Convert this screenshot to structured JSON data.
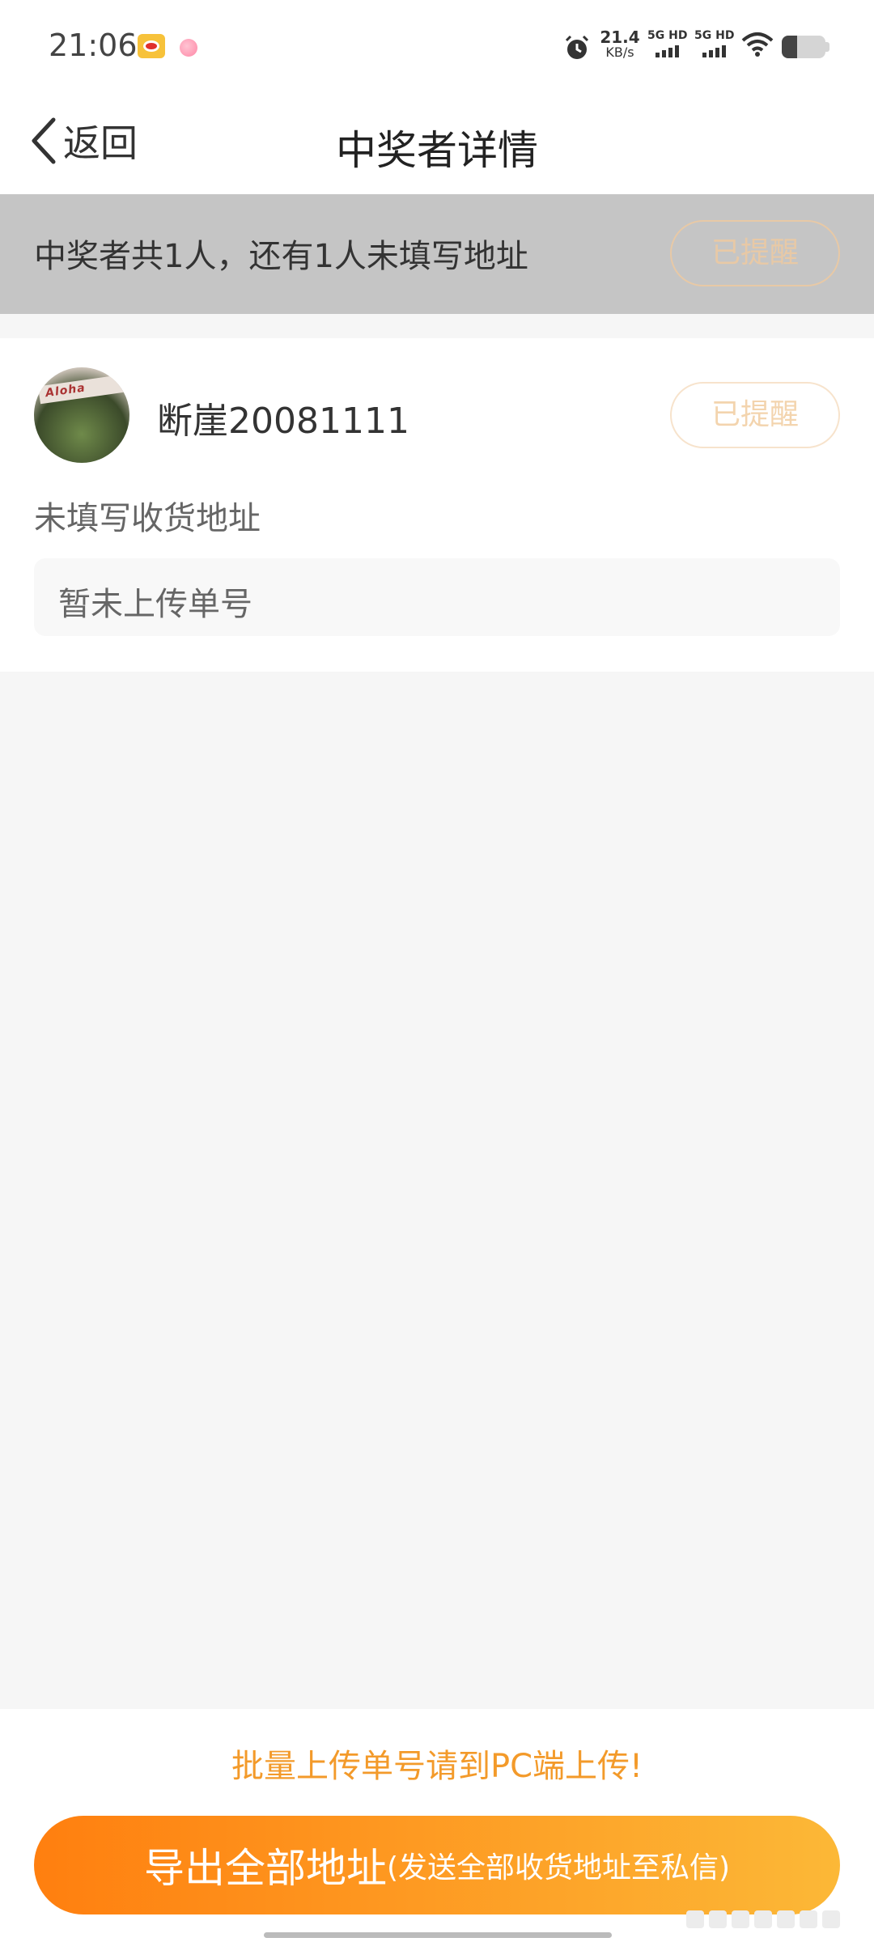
{
  "status_bar": {
    "time": "21:06",
    "net_speed": "21.4",
    "net_unit": "KB/s",
    "sim1_label": "5G HD",
    "sim2_label": "5G HD",
    "battery_level": 0.35,
    "icons": [
      "weibo-icon",
      "pink-dot-icon",
      "alarm-icon",
      "wifi-icon",
      "battery-icon"
    ]
  },
  "nav": {
    "back_label": "返回",
    "title": "中奖者详情"
  },
  "summary": {
    "text": "中奖者共1人，还有1人未填写地址",
    "remind_button": "已提醒"
  },
  "winner": {
    "username": "断崖20081111",
    "remind_button": "已提醒",
    "address_status": "未填写收货地址",
    "tracking_placeholder": "暂未上传单号"
  },
  "footer": {
    "hint": "批量上传单号请到PC端上传!",
    "export_main": "导出全部地址",
    "export_sub": "(发送全部收货地址至私信)"
  },
  "colors": {
    "accent": "#f39a2a",
    "gradient_start": "#ff7f0f",
    "gradient_end": "#fcb837",
    "banner_bg": "#c5c5c5"
  }
}
